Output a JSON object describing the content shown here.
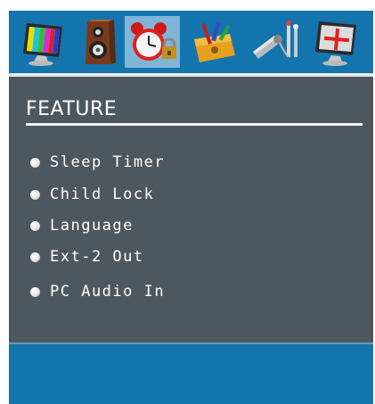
{
  "icon_bar": {
    "icons": [
      {
        "name": "picture-icon"
      },
      {
        "name": "sound-icon"
      },
      {
        "name": "feature-icon",
        "selected": true
      },
      {
        "name": "install-icon"
      },
      {
        "name": "source-icon"
      },
      {
        "name": "pc-picture-icon"
      }
    ]
  },
  "panel": {
    "title": "FEATURE",
    "items": [
      {
        "label": "Sleep Timer"
      },
      {
        "label": "Child Lock"
      },
      {
        "label": "Language"
      },
      {
        "label": "Ext-2 Out"
      },
      {
        "label": "PC Audio In"
      }
    ]
  },
  "colors": {
    "bar_blue": "#1474ad",
    "panel_gray": "#4d5760",
    "selected_tile": "#7fb6d8"
  }
}
